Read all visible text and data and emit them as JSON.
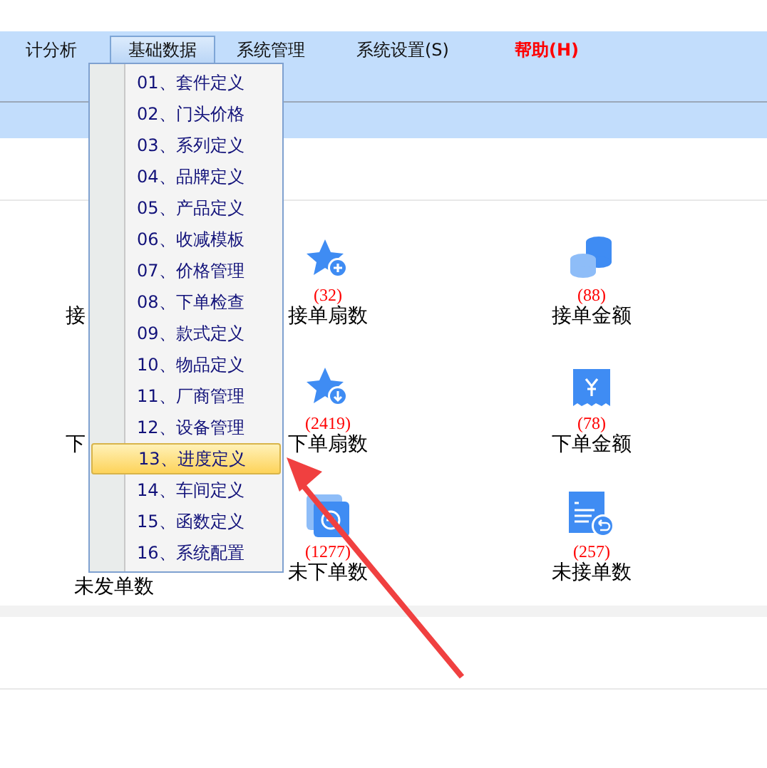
{
  "menubar": [
    {
      "label": "计分析",
      "kind": "normal",
      "selected": false
    },
    {
      "label": "基础数据",
      "kind": "normal",
      "selected": true
    },
    {
      "label": "系统管理",
      "kind": "normal",
      "selected": false
    },
    {
      "label": "系统设置(S)",
      "kind": "normal",
      "selected": false
    },
    {
      "label": "帮助(H)",
      "kind": "help",
      "selected": false
    }
  ],
  "dropdown": [
    {
      "label": "01、套件定义",
      "selected": false
    },
    {
      "label": "02、门头价格",
      "selected": false
    },
    {
      "label": "03、系列定义",
      "selected": false
    },
    {
      "label": "04、品牌定义",
      "selected": false
    },
    {
      "label": "05、产品定义",
      "selected": false
    },
    {
      "label": "06、收减模板",
      "selected": false
    },
    {
      "label": "07、价格管理",
      "selected": false
    },
    {
      "label": "08、下单检查",
      "selected": false
    },
    {
      "label": "09、款式定义",
      "selected": false
    },
    {
      "label": "10、物品定义",
      "selected": false
    },
    {
      "label": "11、厂商管理",
      "selected": false
    },
    {
      "label": "12、设备管理",
      "selected": false
    },
    {
      "label": "13、进度定义",
      "selected": true
    },
    {
      "label": "14、车间定义",
      "selected": false
    },
    {
      "label": "15、函数定义",
      "selected": false
    },
    {
      "label": "16、系统配置",
      "selected": false
    }
  ],
  "stats": [
    [
      {
        "label": "接",
        "kind": "none"
      },
      {
        "count": "(32)",
        "label": "接单扇数",
        "kind": "star-plus"
      },
      {
        "count": "(88)",
        "label": "接单金额",
        "kind": "coins"
      }
    ],
    [
      {
        "label": "下",
        "kind": "none"
      },
      {
        "count": "(2419)",
        "label": "下单扇数",
        "kind": "star-down"
      },
      {
        "count": "(78)",
        "label": "下单金额",
        "kind": "yen"
      }
    ],
    [
      {
        "label": "未发单数",
        "kind": "none"
      },
      {
        "count": "(1277)",
        "label": "未下单数",
        "kind": "minus-card"
      },
      {
        "count": "(257)",
        "label": "未接单数",
        "kind": "doc-return"
      }
    ]
  ]
}
